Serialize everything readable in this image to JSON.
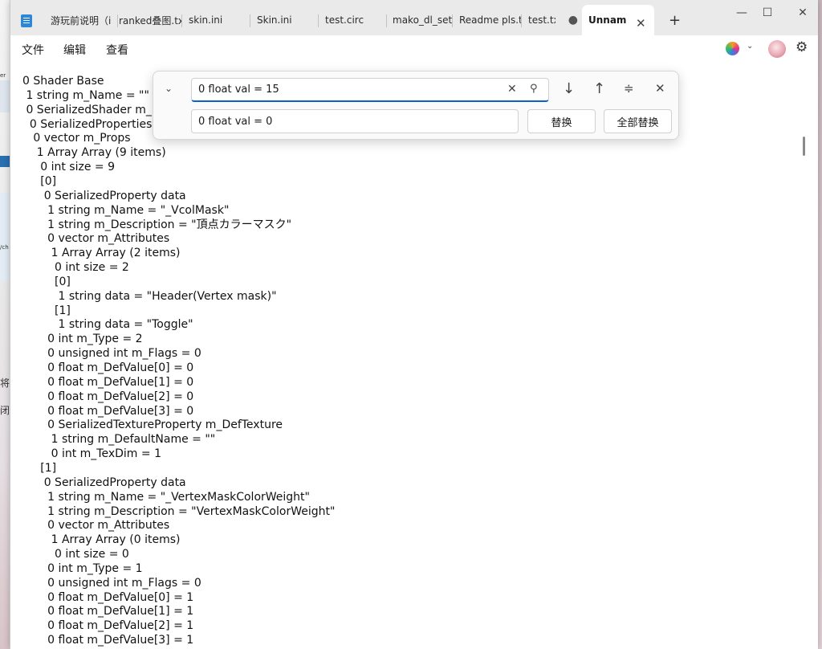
{
  "tabs": [
    {
      "label": "游玩前说明（i",
      "active": false
    },
    {
      "label": "ranked叠图.tx",
      "active": false
    },
    {
      "label": "skin.ini",
      "active": false
    },
    {
      "label": "Skin.ini",
      "active": false
    },
    {
      "label": "test.circ",
      "active": false
    },
    {
      "label": "mako_dl_setu",
      "active": false
    },
    {
      "label": "Readme pls.tx",
      "active": false
    },
    {
      "label": "test.txt",
      "active": false,
      "modified": true
    },
    {
      "label": "Unnam",
      "active": true
    }
  ],
  "window_controls": {
    "minimize": "—",
    "maximize": "☐",
    "close": "✕"
  },
  "new_tab_label": "+",
  "menu": {
    "file": "文件",
    "edit": "编辑",
    "view": "查看"
  },
  "find_replace": {
    "find_value": "0 float val = 15",
    "replace_value": "0 float val = 0",
    "replace_label": "替换",
    "replace_all_label": "全部替换"
  },
  "icons": {
    "notepad": "notepad-icon",
    "copilot": "copilot-icon",
    "settings": "gear-icon"
  },
  "background_glyphs": [
    "er",
    "/ch",
    "将",
    "闭，"
  ],
  "lines": [
    "0 Shader Base",
    " 1 string m_Name = \"\"",
    " 0 SerializedShader m_P",
    "  0 SerializedProperties",
    "   0 vector m_Props",
    "    1 Array Array (9 items)",
    "     0 int size = 9",
    "     [0]",
    "      0 SerializedProperty data",
    "       1 string m_Name = \"_VcolMask\"",
    "       1 string m_Description = \"頂点カラーマスク\"",
    "       0 vector m_Attributes",
    "        1 Array Array (2 items)",
    "         0 int size = 2",
    "         [0]",
    "          1 string data = \"Header(Vertex mask)\"",
    "         [1]",
    "          1 string data = \"Toggle\"",
    "       0 int m_Type = 2",
    "       0 unsigned int m_Flags = 0",
    "       0 float m_DefValue[0] = 0",
    "       0 float m_DefValue[1] = 0",
    "       0 float m_DefValue[2] = 0",
    "       0 float m_DefValue[3] = 0",
    "       0 SerializedTextureProperty m_DefTexture",
    "        1 string m_DefaultName = \"\"",
    "        0 int m_TexDim = 1",
    "     [1]",
    "      0 SerializedProperty data",
    "       1 string m_Name = \"_VertexMaskColorWeight\"",
    "       1 string m_Description = \"VertexMaskColorWeight\"",
    "       0 vector m_Attributes",
    "        1 Array Array (0 items)",
    "         0 int size = 0",
    "       0 int m_Type = 1",
    "       0 unsigned int m_Flags = 0",
    "       0 float m_DefValue[0] = 1",
    "       0 float m_DefValue[1] = 1",
    "       0 float m_DefValue[2] = 1",
    "       0 float m_DefValue[3] = 1"
  ]
}
